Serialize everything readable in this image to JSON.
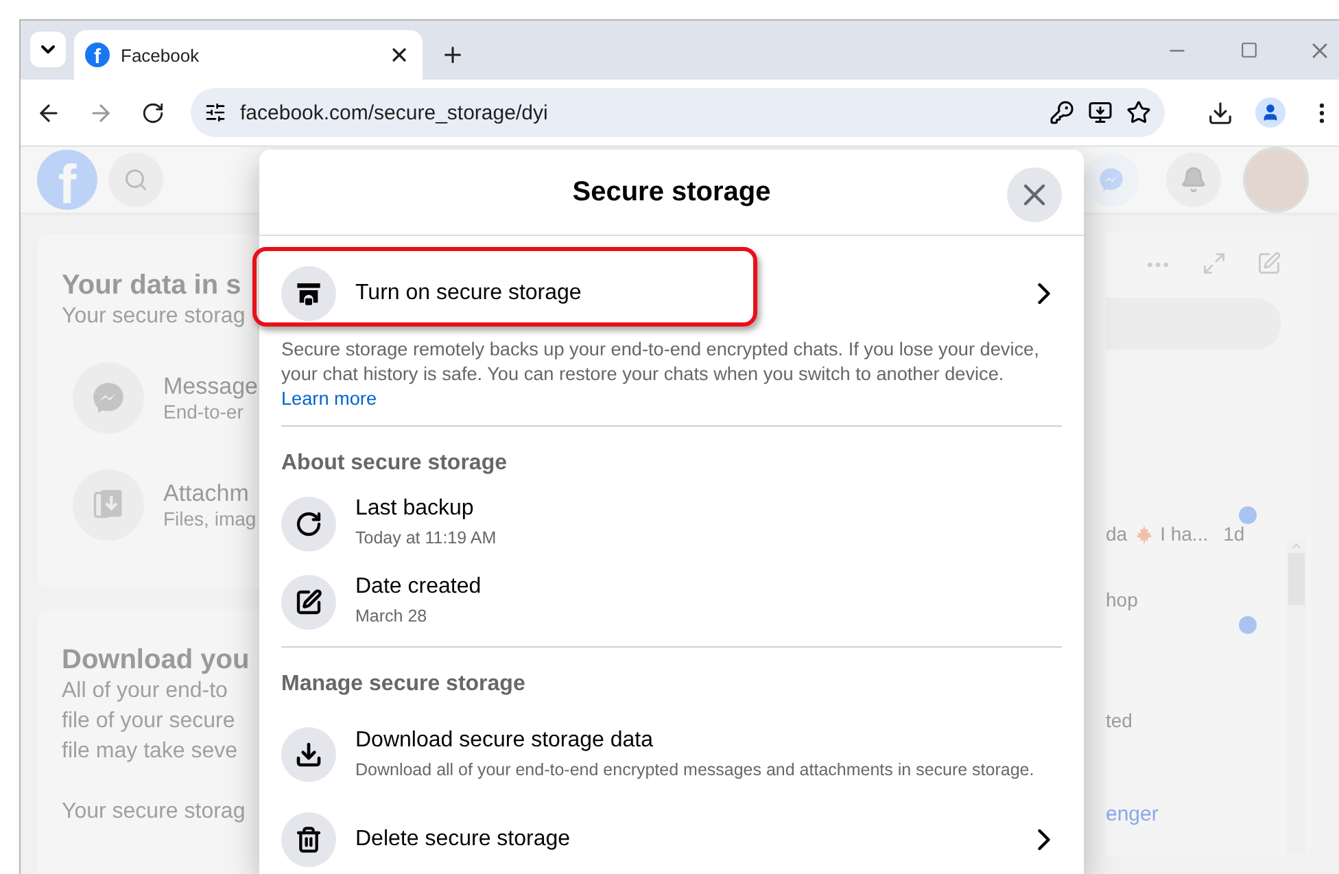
{
  "browser": {
    "tabs": [
      {
        "title": "Facebook",
        "selected": true,
        "favicon": "f"
      }
    ],
    "url": "facebook.com/secure_storage/dyi"
  },
  "page": {
    "logo": "f",
    "cards": [
      {
        "title": "Your data in s",
        "lines": [
          "Your secure storag"
        ],
        "items": [
          {
            "kind": "messenger",
            "title": "Message",
            "subtitle": "End-to-er"
          },
          {
            "kind": "attachment",
            "title": "Attachm",
            "subtitle": "Files, imag"
          }
        ]
      },
      {
        "title": "Download you",
        "lines": [
          "All of your end-to",
          "file of your secure",
          "file may take seve"
        ],
        "note": "Your secure storag"
      }
    ],
    "chats": [
      {
        "name": "da",
        "preview": "I ha...",
        "time": "1d",
        "unread": true
      },
      {
        "preview": "hop",
        "unread": true
      },
      {
        "preview": "ted",
        "unread": false
      }
    ],
    "chats_footer": "enger"
  },
  "dialog": {
    "title": "Secure storage",
    "primary": {
      "label": "Turn on secure storage",
      "highlighted": true
    },
    "description": "Secure storage remotely backs up your end-to-end encrypted chats. If you lose your device, your chat history is safe. You can restore your chats when you switch to another device.",
    "link": "Learn more",
    "sections": [
      {
        "heading": "About secure storage",
        "items": [
          {
            "kind": "backup",
            "title": "Last backup",
            "detail": "Today at 11:19 AM",
            "chevron": false
          },
          {
            "kind": "created",
            "title": "Date created",
            "detail": "March 28",
            "chevron": false
          }
        ]
      },
      {
        "heading": "Manage secure storage",
        "items": [
          {
            "kind": "download",
            "title": "Download secure storage data",
            "detail": "Download all of your end-to-end encrypted messages and attachments in secure storage.",
            "chevron": false
          },
          {
            "kind": "delete",
            "title": "Delete secure storage",
            "chevron": true
          }
        ]
      }
    ]
  }
}
